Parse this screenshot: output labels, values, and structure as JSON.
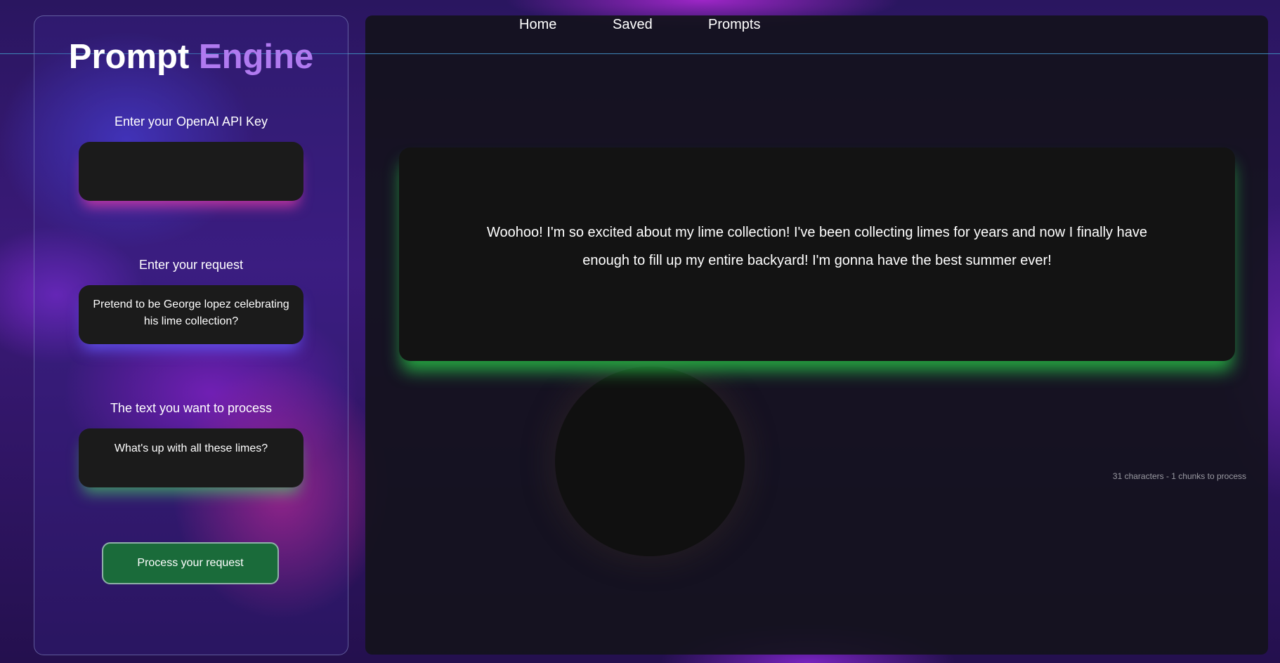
{
  "nav": {
    "home": "Home",
    "saved": "Saved",
    "prompts": "Prompts"
  },
  "brand": {
    "word1": "Prompt",
    "word2": "Engine"
  },
  "form": {
    "api_key_label": "Enter your OpenAI API Key",
    "api_key_value": "",
    "request_label": "Enter your request",
    "request_value": "Pretend to be George lopez celebrating his lime collection?",
    "text_label": "The text you want to process",
    "text_value": "What's up with all these limes?",
    "submit_label": "Process your request"
  },
  "output": {
    "text": "Woohoo! I'm so excited about my lime collection! I've been collecting limes for years and now I finally have enough to fill up my entire backyard! I'm gonna have the best summer ever!",
    "char_count": "31 characters - 1 chunks to process"
  },
  "colors": {
    "accent_purple": "#b07af0",
    "button_green": "#1a6b3a",
    "glow_green": "#28be46",
    "glow_pink": "#e63caa",
    "glow_blue": "#645aff"
  }
}
